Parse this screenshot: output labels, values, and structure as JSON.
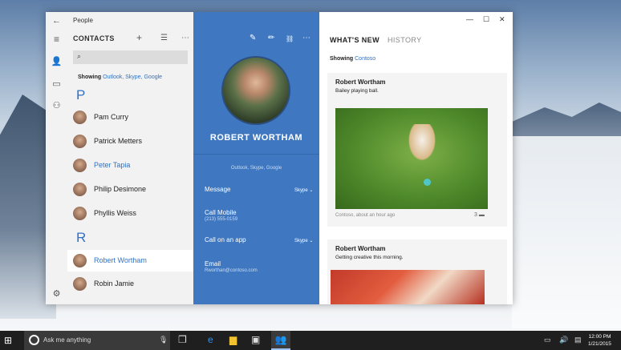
{
  "app": {
    "name": "People"
  },
  "list": {
    "title": "CONTACTS",
    "search_icon": "⌕",
    "showing_label": "Showing",
    "showing_sources": "Outlook, Skype, Google",
    "groups": [
      {
        "letter": "P"
      },
      {
        "letter": "R"
      }
    ],
    "contacts": [
      {
        "name": "Pam Curry"
      },
      {
        "name": "Patrick Metters"
      },
      {
        "name": "Peter Tapia"
      },
      {
        "name": "Philip Desimone"
      },
      {
        "name": "Phyllis Weiss"
      },
      {
        "name": "Robert Wortham"
      },
      {
        "name": "Robin Jamie"
      }
    ]
  },
  "detail": {
    "name": "ROBERT WORTHAM",
    "sources": "Outlook, Skype, Google",
    "message": {
      "label": "Message",
      "via": "Skype ⌄"
    },
    "call_mobile": {
      "label": "Call Mobile",
      "number": "(213) 555-0159"
    },
    "call_app": {
      "label": "Call on an app",
      "via": "Skype ⌄"
    },
    "email": {
      "label": "Email",
      "address": "Rworthan@contoso.com"
    }
  },
  "feed": {
    "tab_active": "WHAT'S NEW",
    "tab_inactive": "HISTORY",
    "showing_label": "Showing",
    "showing_source": "Contoso",
    "posts": [
      {
        "author": "Robert Wortham",
        "caption": "Bailey playing ball.",
        "meta": "Contoso, about an hour ago",
        "comments": "3"
      },
      {
        "author": "Robert Wortham",
        "caption": "Getting creative this morning."
      }
    ]
  },
  "taskbar": {
    "search_placeholder": "Ask me anything",
    "time": "12:00 PM",
    "date": "1/21/2015"
  },
  "colors": {
    "accent": "#3f78c1",
    "link": "#2f72c4"
  }
}
